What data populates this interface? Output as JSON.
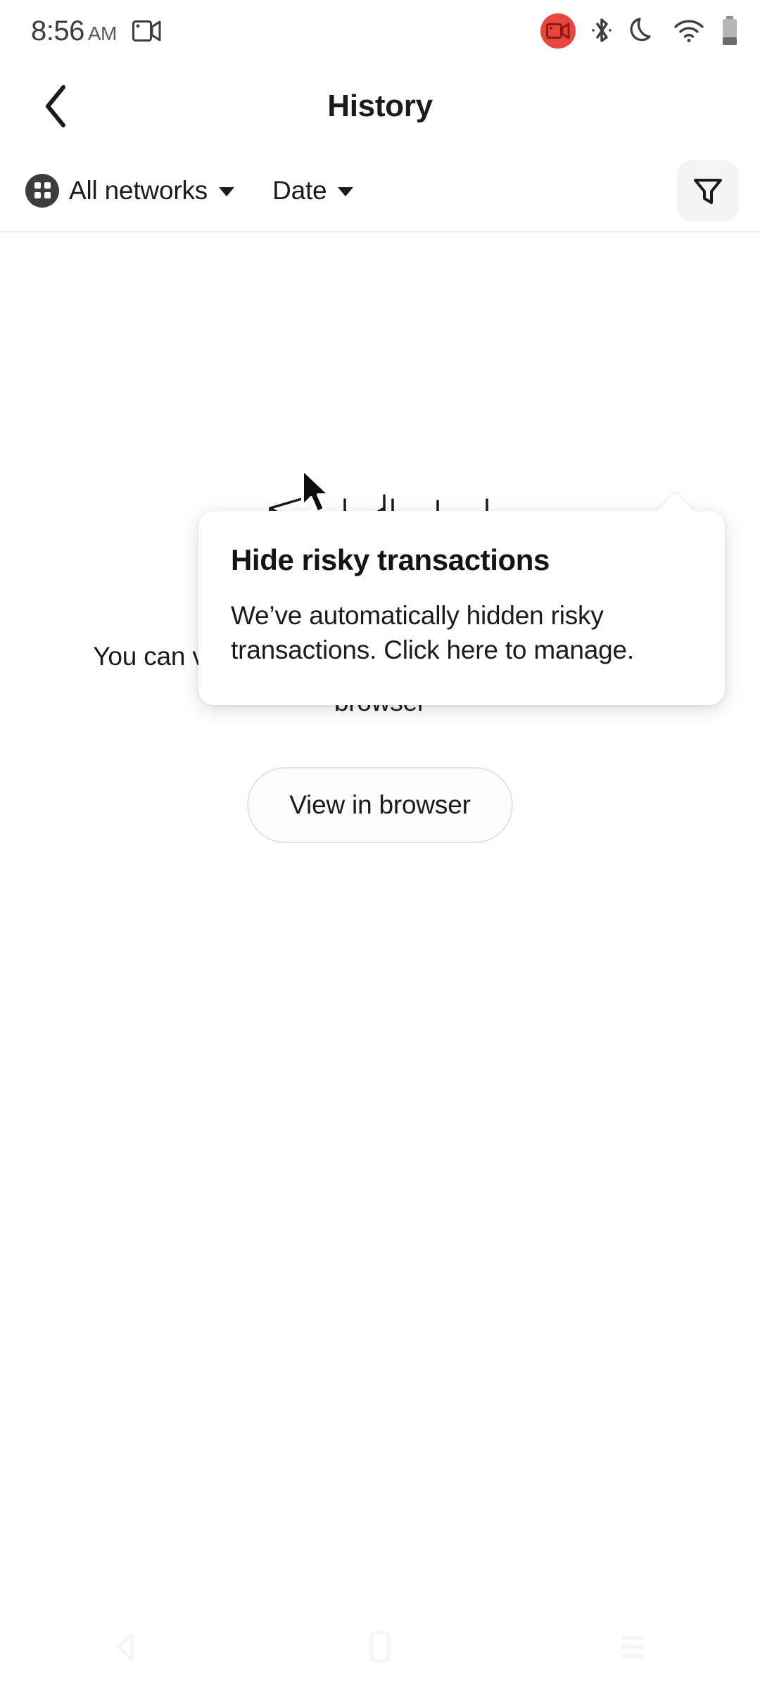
{
  "status_bar": {
    "time": "8:56",
    "ampm": "AM",
    "screen_record_icon": "video-camera-icon",
    "icons": [
      {
        "name": "screen-recording-badge-icon",
        "color": "#e8453c"
      },
      {
        "name": "bluetooth-icon"
      },
      {
        "name": "do-not-disturb-moon-icon"
      },
      {
        "name": "wifi-icon"
      },
      {
        "name": "battery-icon"
      }
    ]
  },
  "header": {
    "back_icon": "chevron-left-icon",
    "title": "History"
  },
  "filter_bar": {
    "networks_icon": "grid-apps-icon",
    "networks_label": "All networks",
    "date_label": "Date",
    "filter_icon": "funnel-filter-icon"
  },
  "tooltip": {
    "title": "Hide risky transactions",
    "body": "We’ve automatically hidden risky transactions. Click here to manage."
  },
  "empty_state": {
    "illustration": "empty-drawer-illustration",
    "accent_color": "#c2f03b",
    "message": "You can view more about transaction history in the browser",
    "button_label": "View in browser"
  },
  "nav_bar": {
    "back": "nav-back-icon",
    "home": "nav-home-icon",
    "recents": "nav-recents-icon"
  }
}
